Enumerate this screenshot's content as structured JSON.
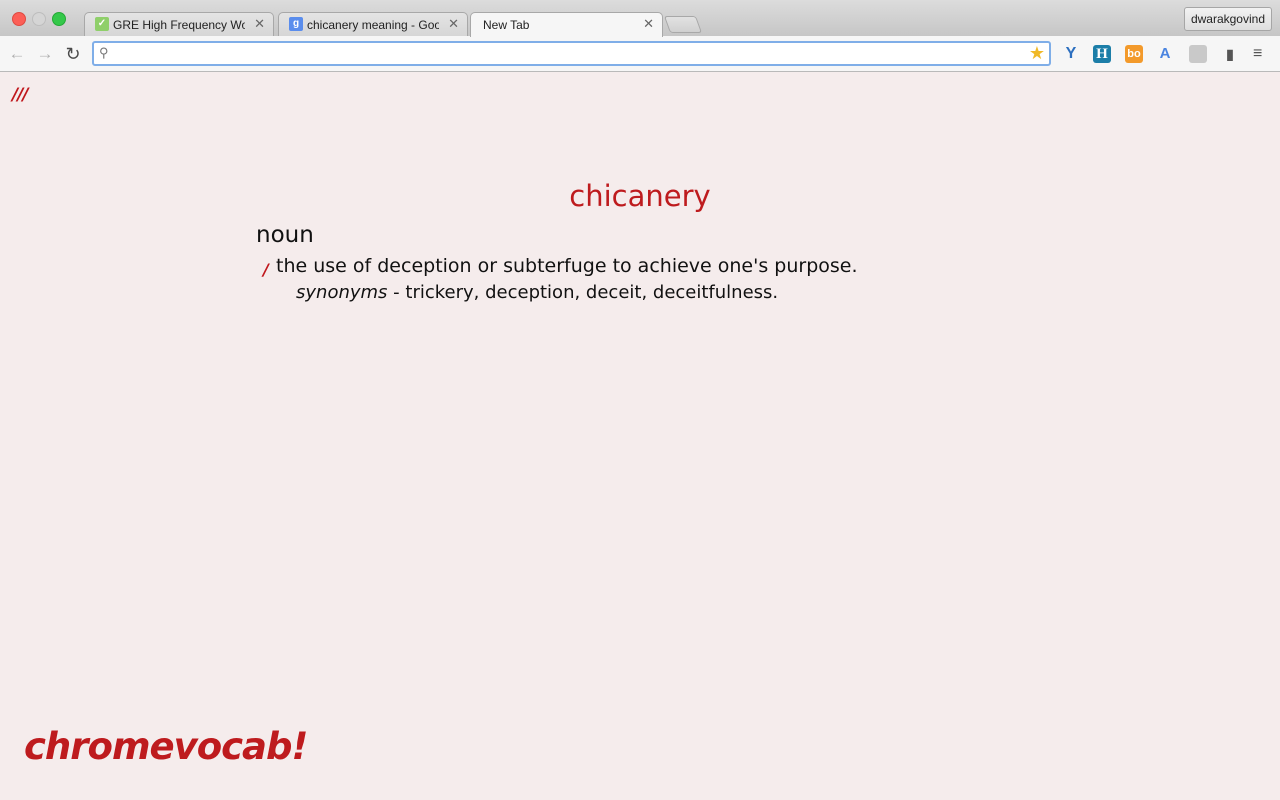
{
  "browser": {
    "tabs": [
      {
        "title": "GRE High Frequency Words",
        "favicon": "check-icon",
        "active": false
      },
      {
        "title": "chicanery meaning - Google",
        "favicon": "google-icon",
        "active": false
      },
      {
        "title": "New Tab",
        "favicon": "",
        "active": true
      }
    ],
    "profile_name": "dwarakgovind",
    "omnibox": {
      "value": "",
      "placeholder": ""
    },
    "extensions": [
      "y-extension-icon",
      "h-extension-icon",
      "bo-extension-icon",
      "translate-icon",
      "gray-extension-icon",
      "trash-extension-icon"
    ]
  },
  "page": {
    "corner_logo": "///",
    "word": "chicanery",
    "part_of_speech": "noun",
    "bullet": "/",
    "definition": "the use of deception or subterfuge to achieve one's purpose.",
    "synonyms_label": "synonyms",
    "synonyms_separator": " - ",
    "synonyms": "trickery, deception, deceit, deceitfulness.",
    "brand": "chromevocab!"
  },
  "colors": {
    "accent_red": "#be1b1e",
    "page_background": "#f5ecec",
    "omnibox_focus": "#7faee8"
  }
}
